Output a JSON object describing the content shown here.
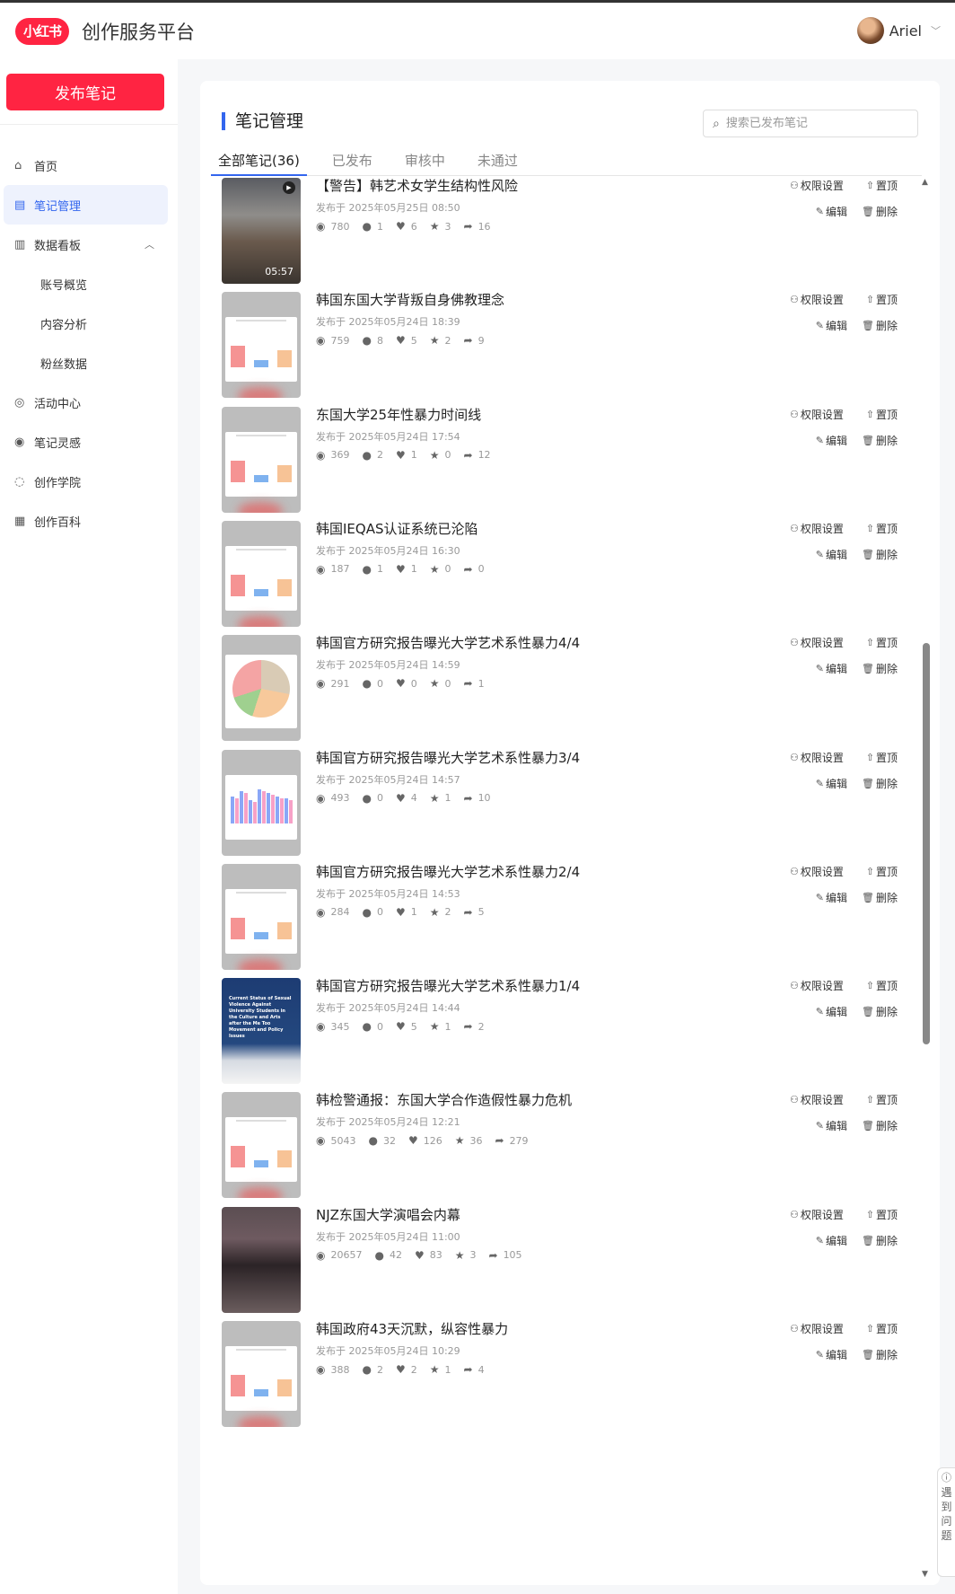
{
  "header": {
    "logo": "小红书",
    "platform": "创作服务平台",
    "user": "Ariel"
  },
  "sidebar": {
    "publish": "发布笔记",
    "items": [
      {
        "label": "首页",
        "icon": "home-icon",
        "glyph": "⌂"
      },
      {
        "label": "笔记管理",
        "icon": "note-icon",
        "glyph": "▤",
        "active": true
      },
      {
        "label": "数据看板",
        "icon": "chart-icon",
        "glyph": "▥",
        "expanded": true
      },
      {
        "label": "账号概览",
        "sub": true
      },
      {
        "label": "内容分析",
        "sub": true
      },
      {
        "label": "粉丝数据",
        "sub": true
      },
      {
        "label": "活动中心",
        "icon": "activity-icon",
        "glyph": "◎"
      },
      {
        "label": "笔记灵感",
        "icon": "inspiration-icon",
        "glyph": "◉"
      },
      {
        "label": "创作学院",
        "icon": "academy-icon",
        "glyph": "◌"
      },
      {
        "label": "创作百科",
        "icon": "wiki-icon",
        "glyph": "▦"
      }
    ]
  },
  "main": {
    "title": "笔记管理",
    "search_placeholder": "搜索已发布笔记",
    "tabs": [
      {
        "label": "全部笔记(36)",
        "active": true
      },
      {
        "label": "已发布"
      },
      {
        "label": "审核中"
      },
      {
        "label": "未通过"
      }
    ],
    "actions": {
      "permission": "权限设置",
      "pin": "置顶",
      "edit": "编辑",
      "delete": "删除"
    },
    "notes": [
      {
        "title": "【警告】韩艺术女学生结构性风险",
        "date": "发布于 2025年05月25日 08:50",
        "views": "780",
        "comments": "1",
        "likes": "6",
        "collects": "3",
        "shares": "16",
        "thumb": "video",
        "duration": "05:57"
      },
      {
        "title": "韩国东国大学背叛自身佛教理念",
        "date": "发布于 2025年05月24日 18:39",
        "views": "759",
        "comments": "8",
        "likes": "5",
        "collects": "2",
        "shares": "9",
        "thumb": "bar"
      },
      {
        "title": "东国大学25年性暴力时间线",
        "date": "发布于 2025年05月24日 17:54",
        "views": "369",
        "comments": "2",
        "likes": "1",
        "collects": "0",
        "shares": "12",
        "thumb": "bar"
      },
      {
        "title": "韩国IEQAS认证系统已沦陷",
        "date": "发布于 2025年05月24日 16:30",
        "views": "187",
        "comments": "1",
        "likes": "1",
        "collects": "0",
        "shares": "0",
        "thumb": "bar"
      },
      {
        "title": "韩国官方研究报告曝光大学艺术系性暴力4/4",
        "date": "发布于 2025年05月24日 14:59",
        "views": "291",
        "comments": "0",
        "likes": "0",
        "collects": "0",
        "shares": "1",
        "thumb": "pie"
      },
      {
        "title": "韩国官方研究报告曝光大学艺术系性暴力3/4",
        "date": "发布于 2025年05月24日 14:57",
        "views": "493",
        "comments": "0",
        "likes": "4",
        "collects": "1",
        "shares": "10",
        "thumb": "multibar"
      },
      {
        "title": "韩国官方研究报告曝光大学艺术系性暴力2/4",
        "date": "发布于 2025年05月24日 14:53",
        "views": "284",
        "comments": "0",
        "likes": "1",
        "collects": "2",
        "shares": "5",
        "thumb": "bar"
      },
      {
        "title": "韩国官方研究报告曝光大学艺术系性暴力1/4",
        "date": "发布于 2025年05月24日 14:44",
        "views": "345",
        "comments": "0",
        "likes": "5",
        "collects": "1",
        "shares": "2",
        "thumb": "cover",
        "cover_text": "Current Status of Sexual Violence Against University Students in the Culture and Arts after the Me Too Movement and Policy Issues"
      },
      {
        "title": "韩检警通报：东国大学合作造假性暴力危机",
        "date": "发布于 2025年05月24日 12:21",
        "views": "5043",
        "comments": "32",
        "likes": "126",
        "collects": "36",
        "shares": "279",
        "thumb": "bar"
      },
      {
        "title": "NJZ东国大学演唱会内幕",
        "date": "发布于 2025年05月24日 11:00",
        "views": "20657",
        "comments": "42",
        "likes": "83",
        "collects": "3",
        "shares": "105",
        "thumb": "concert"
      },
      {
        "title": "韩国政府43天沉默，纵容性暴力",
        "date": "发布于 2025年05月24日 10:29",
        "views": "388",
        "comments": "2",
        "likes": "2",
        "collects": "1",
        "shares": "4",
        "thumb": "bar"
      }
    ]
  },
  "help": "遇到问题"
}
